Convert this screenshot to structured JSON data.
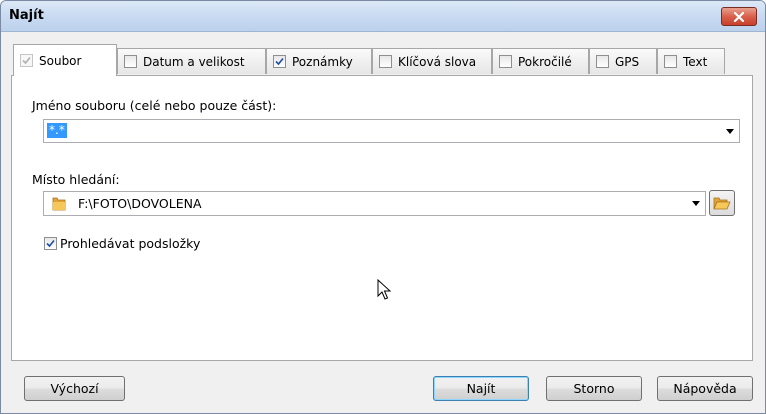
{
  "window": {
    "title": "Najít"
  },
  "tabs": [
    {
      "label": "Soubor",
      "checked": true,
      "disabled": true,
      "active": true
    },
    {
      "label": "Datum a velikost",
      "checked": false
    },
    {
      "label": "Poznámky",
      "checked": true
    },
    {
      "label": "Klíčová slova",
      "checked": false
    },
    {
      "label": "Pokročilé",
      "checked": false
    },
    {
      "label": "GPS",
      "checked": false
    },
    {
      "label": "Text",
      "checked": false
    }
  ],
  "filename": {
    "label": "Jméno souboru (celé nebo pouze část):",
    "value": "*.*"
  },
  "location": {
    "label": "Místo hledání:",
    "value": "F:\\FOTO\\DOVOLENA"
  },
  "subfolders": {
    "label": "Prohledávat podsložky",
    "checked": true
  },
  "buttons": {
    "defaults": "Výchozí",
    "find": "Najít",
    "cancel": "Storno",
    "help": "Nápověda"
  },
  "colors": {
    "selection": "#3399ff",
    "titlebar": "#c9dbf2",
    "close": "#d8604b"
  },
  "icons": {
    "close": "close-x-icon",
    "folder": "folder-icon",
    "browse": "open-folder-icon",
    "cursor": "mouse-pointer-icon"
  }
}
